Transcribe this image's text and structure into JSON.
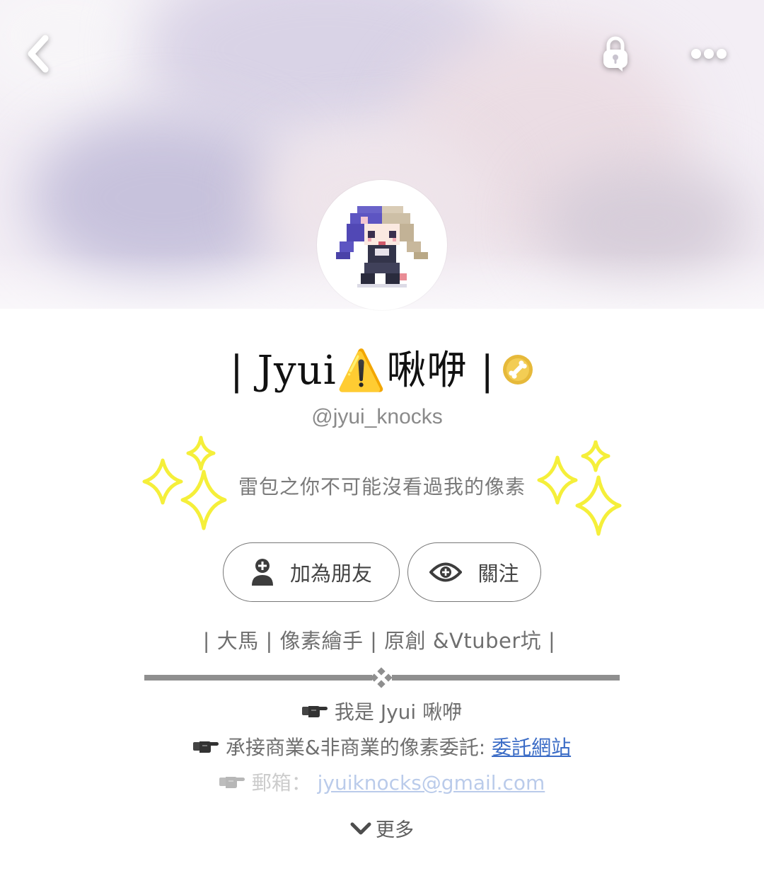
{
  "profile": {
    "display_name": "| Jyui⚠️啾咿 |",
    "handle": "@jyui_knocks",
    "tagline": "雷包之你不可能沒看過我的像素"
  },
  "actions": {
    "add_friend_label": "加為朋友",
    "follow_label": "關注"
  },
  "about": {
    "info_line": "| 大馬 | 像素繪手 | 原創 &Vtuber坑 |",
    "lines": [
      {
        "text": "我是 Jyui 啾咿",
        "link": ""
      },
      {
        "text": "承接商業&非商業的像素委託: ",
        "link": "委託網站"
      },
      {
        "text": "郵箱： ",
        "link": "jyuiknocks@gmail.com"
      }
    ],
    "more_label": "更多"
  },
  "icons": {
    "back": "chevron-left-icon",
    "lock": "lock-icon",
    "more": "more-dots-icon",
    "medal": "bone-medal-icon",
    "add_friend": "add-user-icon",
    "follow": "eye-icon",
    "pointer": "pointing-hand-icon",
    "expand": "chevron-down-icon"
  },
  "colors": {
    "link": "#3b6cc6",
    "sparkle": "#f5ef3a",
    "medal": "#e6b93a",
    "divider": "#8f8f8f"
  }
}
